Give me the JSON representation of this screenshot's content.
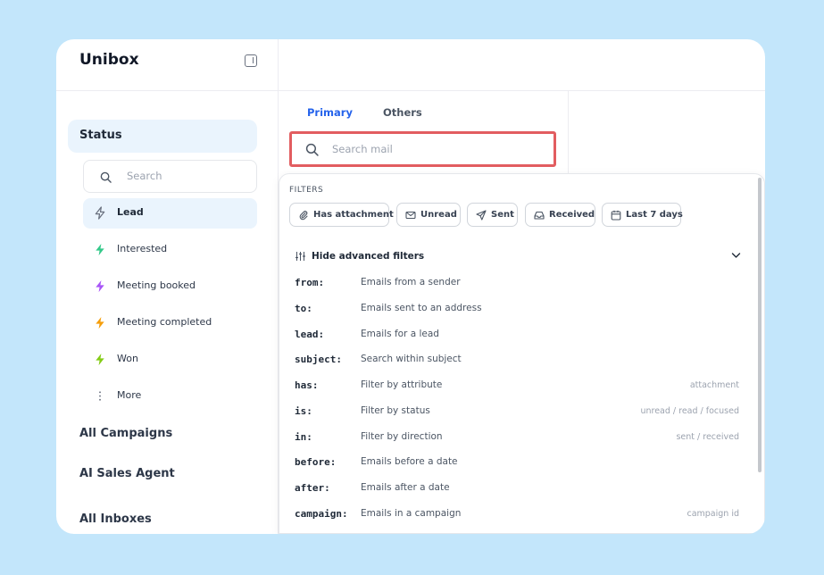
{
  "sidebar": {
    "app_title": "Unibox",
    "status_label": "Status",
    "search_placeholder": "Search",
    "statuses": [
      {
        "label": "Lead",
        "color": "#6b7280",
        "active": true
      },
      {
        "label": "Interested",
        "color": "#34c98a"
      },
      {
        "label": "Meeting booked",
        "color": "#a855f7"
      },
      {
        "label": "Meeting completed",
        "color": "#f59e0b"
      },
      {
        "label": "Won",
        "color": "#84cc16"
      },
      {
        "label": "More"
      }
    ],
    "nav": [
      "All Campaigns",
      "AI Sales Agent",
      "All Inboxes"
    ]
  },
  "tabs": {
    "primary": "Primary",
    "others": "Others"
  },
  "search": {
    "placeholder": "Search mail",
    "value": ""
  },
  "dropdown": {
    "filters_heading": "FILTERS",
    "chips": [
      "Has attachment",
      "Unread",
      "Sent",
      "Received",
      "Last 7 days"
    ],
    "advanced_toggle": "Hide advanced filters",
    "operators": [
      {
        "key": "from:",
        "desc": "Emails from a sender",
        "hint": ""
      },
      {
        "key": "to:",
        "desc": "Emails sent to an address",
        "hint": ""
      },
      {
        "key": "lead:",
        "desc": "Emails for a lead",
        "hint": ""
      },
      {
        "key": "subject:",
        "desc": "Search within subject",
        "hint": ""
      },
      {
        "key": "has:",
        "desc": "Filter by attribute",
        "hint": "attachment"
      },
      {
        "key": "is:",
        "desc": "Filter by status",
        "hint": "unread / read / focused"
      },
      {
        "key": "in:",
        "desc": "Filter by direction",
        "hint": "sent / received"
      },
      {
        "key": "before:",
        "desc": "Emails before a date",
        "hint": ""
      },
      {
        "key": "after:",
        "desc": "Emails after a date",
        "hint": ""
      },
      {
        "key": "campaign:",
        "desc": "Emails in a campaign",
        "hint": "campaign id"
      }
    ]
  },
  "colors": {
    "accent": "#2563eb",
    "highlight_border": "#e25d60",
    "background": "#c3e6fb"
  }
}
